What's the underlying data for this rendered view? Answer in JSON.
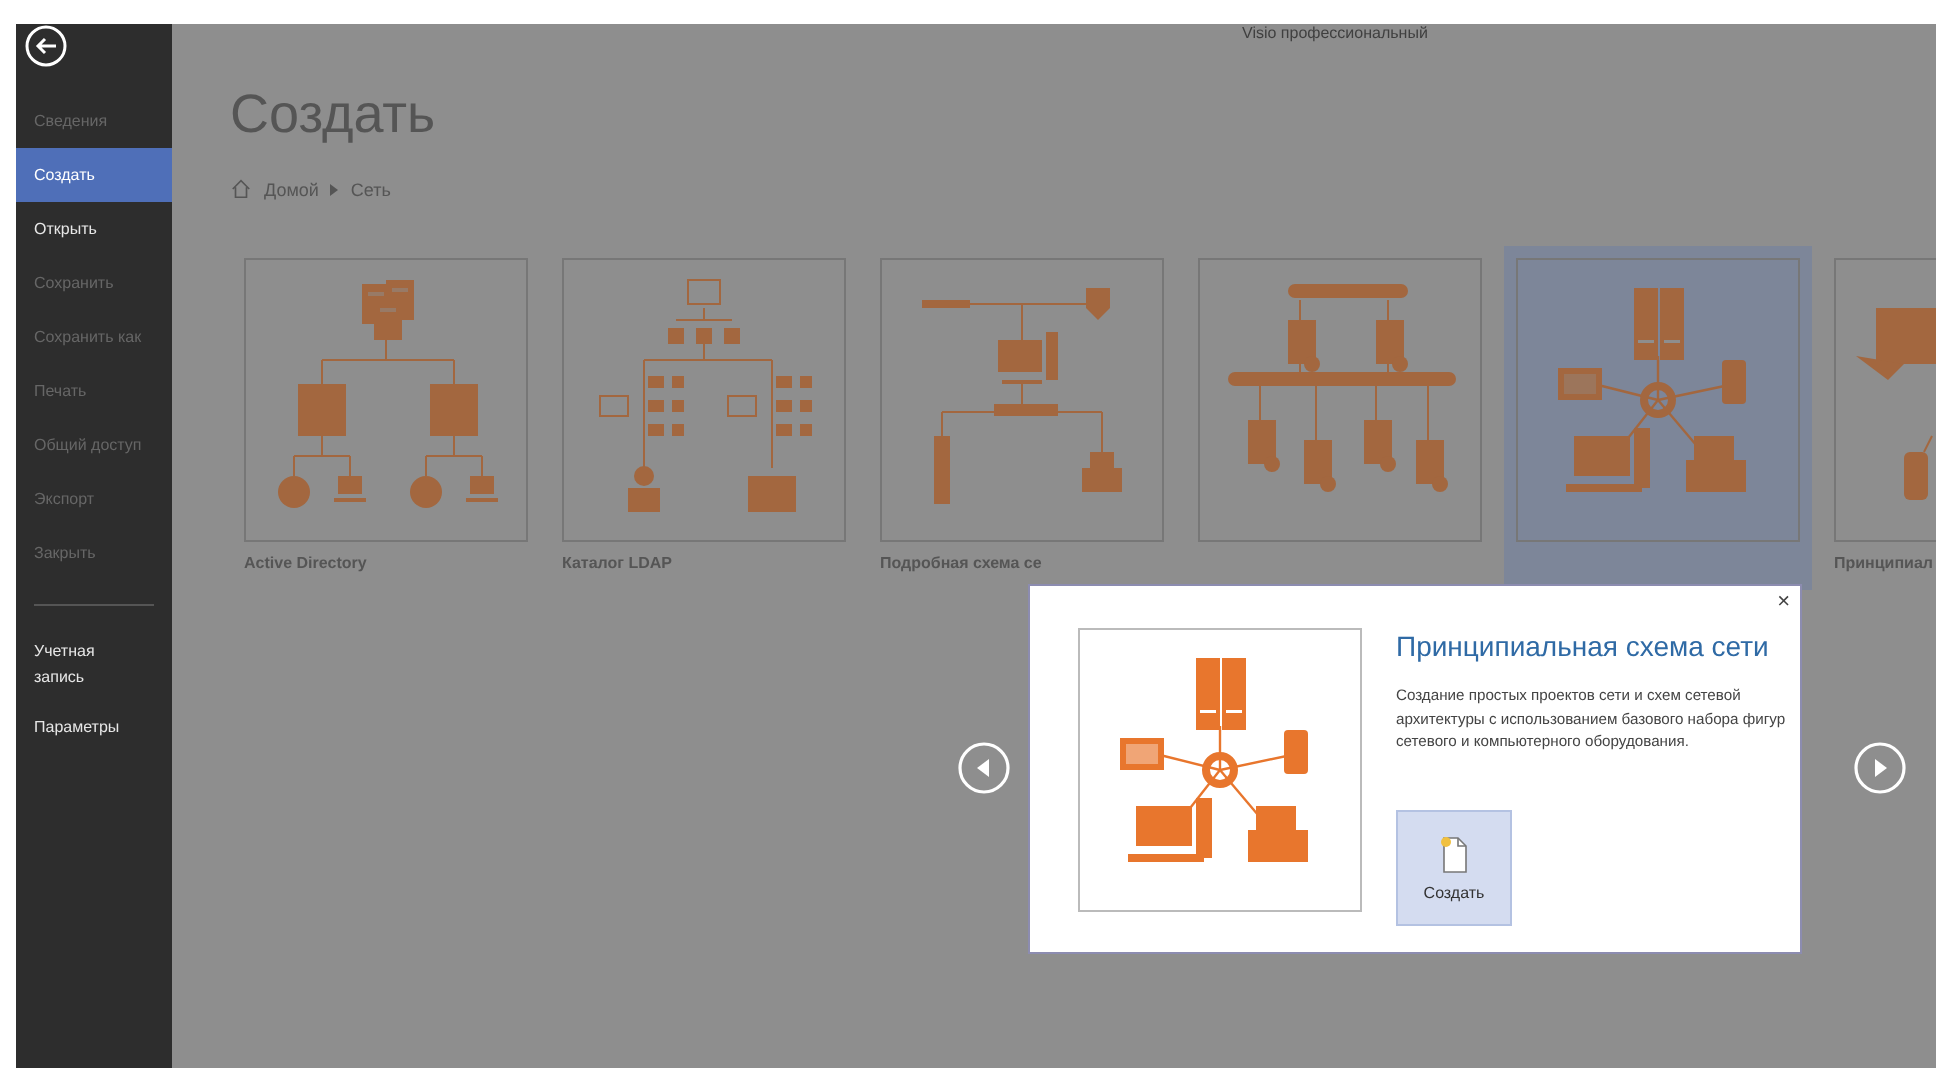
{
  "app_title": "Visio профессиональный",
  "sidebar": {
    "items": [
      {
        "label": "Сведения",
        "selected": false,
        "disabled": true
      },
      {
        "label": "Создать",
        "selected": true,
        "disabled": false
      },
      {
        "label": "Открыть",
        "selected": false,
        "disabled": false
      },
      {
        "label": "Сохранить",
        "selected": false,
        "disabled": true
      },
      {
        "label": "Сохранить как",
        "selected": false,
        "disabled": true
      },
      {
        "label": "Печать",
        "selected": false,
        "disabled": true
      },
      {
        "label": "Общий доступ",
        "selected": false,
        "disabled": true
      },
      {
        "label": "Экспорт",
        "selected": false,
        "disabled": true
      },
      {
        "label": "Закрыть",
        "selected": false,
        "disabled": true
      }
    ],
    "bottom_items": [
      {
        "label": "Учетная запись",
        "selected": false,
        "disabled": false
      },
      {
        "label": "Параметры",
        "selected": false,
        "disabled": false
      }
    ]
  },
  "page": {
    "title": "Создать",
    "breadcrumb": [
      "Домой",
      "Сеть"
    ]
  },
  "templates": [
    {
      "label": "Active Directory",
      "selected": false
    },
    {
      "label": "Каталог LDAP",
      "selected": false
    },
    {
      "label": "Подробная схема се",
      "selected": false
    },
    {
      "selected": false
    },
    {
      "selected": true
    },
    {
      "label": "Принципиал",
      "selected": false
    }
  ],
  "dialog": {
    "close": "×",
    "title": "Принципиальная схема сети",
    "description": "Создание простых проектов сети и схем сетевой архитектуры с использованием базового набора фигур сетевого и компьютерного оборудования.",
    "create_button": "Создать"
  }
}
